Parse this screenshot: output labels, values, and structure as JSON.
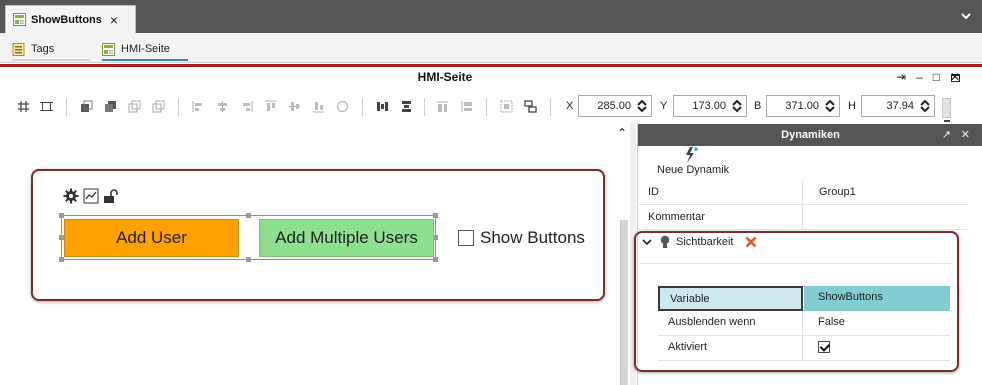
{
  "tabs": {
    "document_tab": "ShowButtons",
    "subtabs": [
      "Tags",
      "HMI-Seite"
    ]
  },
  "editor": {
    "title": "HMI-Seite",
    "coords": [
      {
        "label": "X",
        "value": "285.00"
      },
      {
        "label": "Y",
        "value": "173.00"
      },
      {
        "label": "B",
        "value": "371.00"
      },
      {
        "label": "H",
        "value": "37.94"
      }
    ]
  },
  "canvas": {
    "button_add_user": "Add User",
    "button_add_multiple": "Add Multiple Users",
    "checkbox_label": "Show Buttons",
    "colors": {
      "add_user": "#ffa100",
      "add_multiple": "#8ee08e"
    }
  },
  "dynamics": {
    "header": "Dynamiken",
    "new_label": "Neue Dynamik",
    "id_label": "ID",
    "id_value": "Group1",
    "comment_label": "Kommentar",
    "section": "Sichtbarkeit",
    "rows": [
      {
        "key": "Variable",
        "value": "ShowButtons"
      },
      {
        "key": "Ausblenden wenn",
        "value": "False"
      },
      {
        "key": "Aktiviert",
        "checked": true
      }
    ]
  }
}
